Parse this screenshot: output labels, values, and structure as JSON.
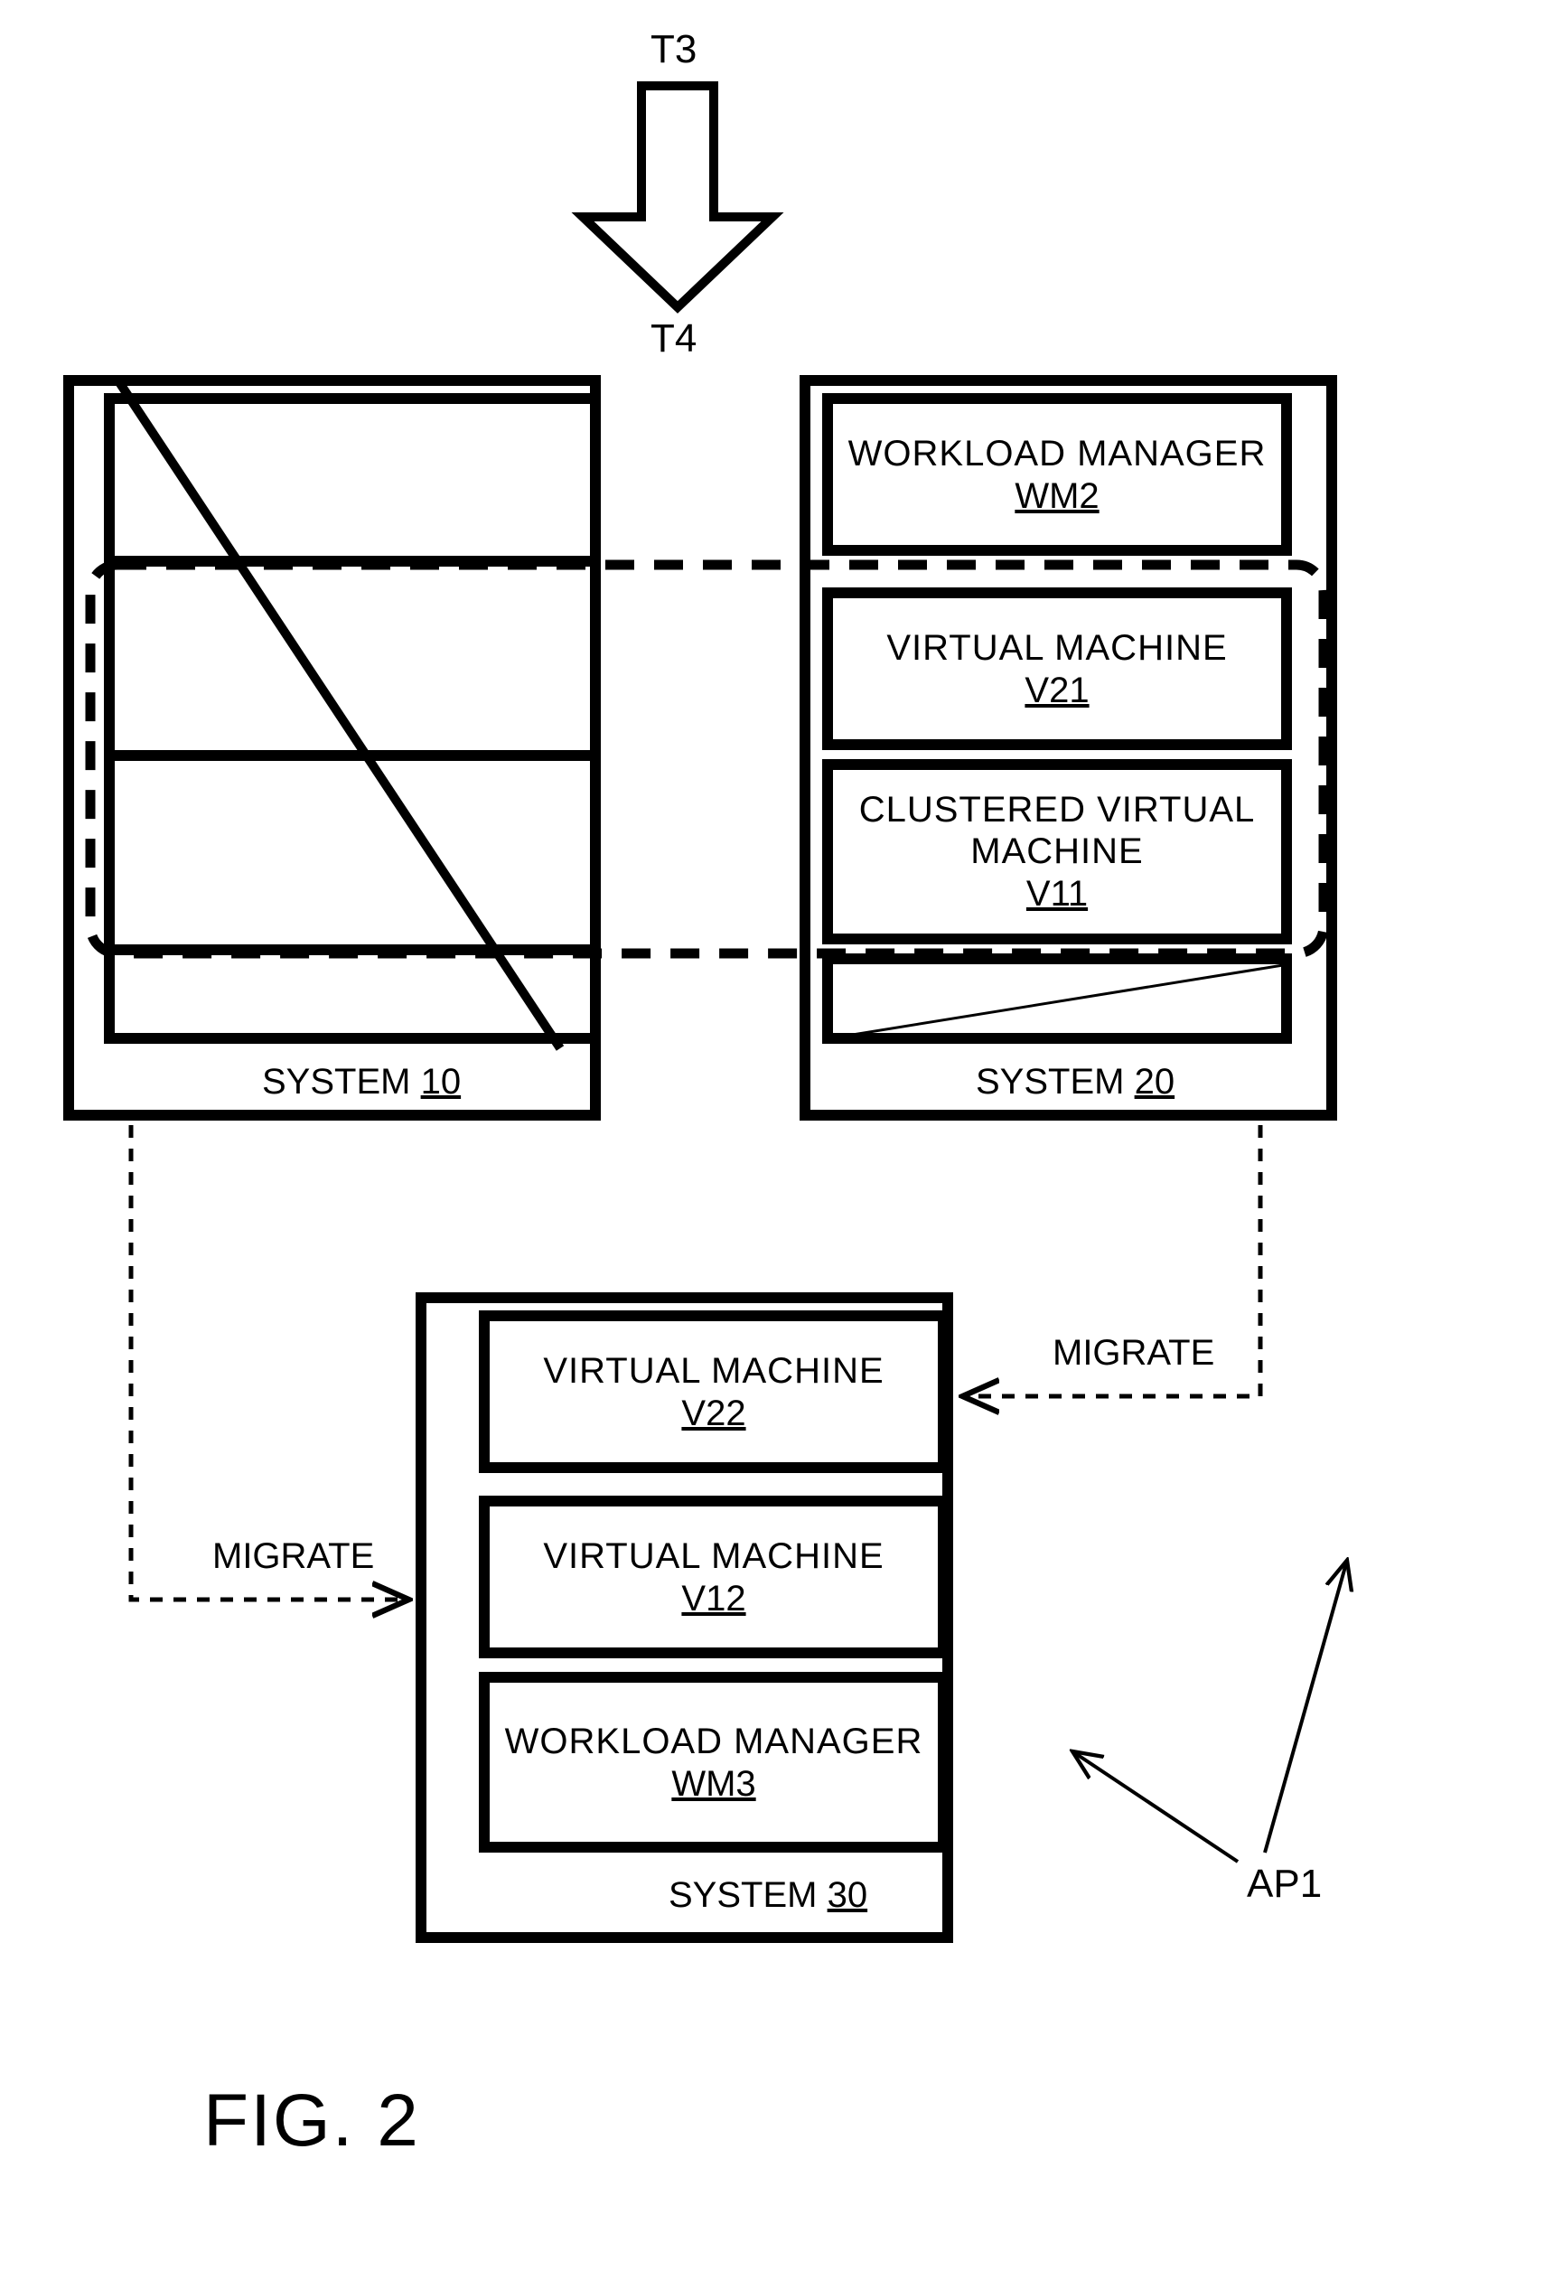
{
  "labels": {
    "t3": "T3",
    "t4": "T4",
    "fig": "FIG. 2",
    "ap1": "AP1",
    "migrate_left": "MIGRATE",
    "migrate_right": "MIGRATE"
  },
  "system10": {
    "label": "SYSTEM",
    "id": "10"
  },
  "system20": {
    "label": "SYSTEM",
    "id": "20",
    "wm2_label": "WORKLOAD MANAGER",
    "wm2_id": "WM2",
    "v21_label": "VIRTUAL MACHINE",
    "v21_id": "V21",
    "v11_label": "CLUSTERED VIRTUAL MACHINE",
    "v11_id": "V11"
  },
  "system30": {
    "label": "SYSTEM",
    "id": "30",
    "v22_label": "VIRTUAL MACHINE",
    "v22_id": "V22",
    "v12_label": "VIRTUAL MACHINE",
    "v12_id": "V12",
    "wm3_label": "WORKLOAD MANAGER",
    "wm3_id": "WM3"
  }
}
